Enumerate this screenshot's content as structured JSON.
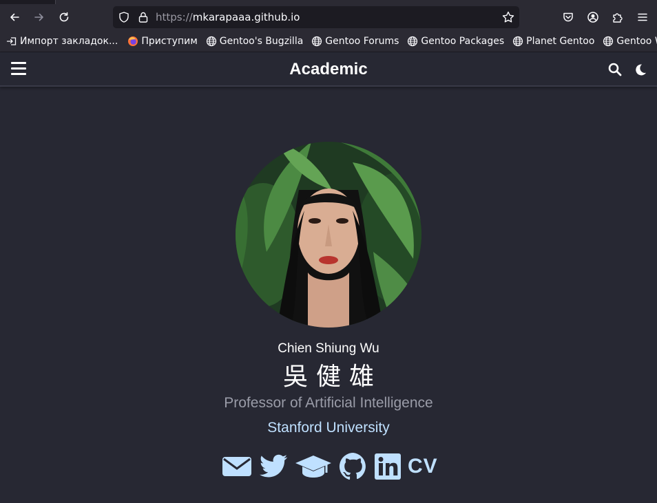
{
  "browser": {
    "url_protocol": "https://",
    "url_host": "mkarapaaa.github.io",
    "bookmarks": [
      {
        "label": "Импорт закладок...",
        "icon": "import-icon"
      },
      {
        "label": "Приступим",
        "icon": "firefox-icon"
      },
      {
        "label": "Gentoo's Bugzilla",
        "icon": "globe-icon"
      },
      {
        "label": "Gentoo Forums",
        "icon": "globe-icon"
      },
      {
        "label": "Gentoo Packages",
        "icon": "globe-icon"
      },
      {
        "label": "Planet Gentoo",
        "icon": "globe-icon"
      },
      {
        "label": "Gentoo Wiki",
        "icon": "globe-icon"
      }
    ]
  },
  "site": {
    "title": "Academic"
  },
  "profile": {
    "name": "Chien Shiung Wu",
    "name_cn": "吳健雄",
    "role": "Professor of Artificial Intelligence",
    "organization": "Stanford University",
    "social": [
      {
        "icon": "envelope-icon"
      },
      {
        "icon": "twitter-icon"
      },
      {
        "icon": "graduation-cap-icon"
      },
      {
        "icon": "github-icon"
      },
      {
        "icon": "linkedin-icon"
      },
      {
        "icon": "cv-icon",
        "label": "CV"
      }
    ]
  },
  "colors": {
    "page_background": "#272833",
    "accent": "#bfe0ff",
    "muted_text": "#9a9ca8",
    "browser_toolbar": "#2b2a33",
    "urlbar": "#1c1b22"
  }
}
